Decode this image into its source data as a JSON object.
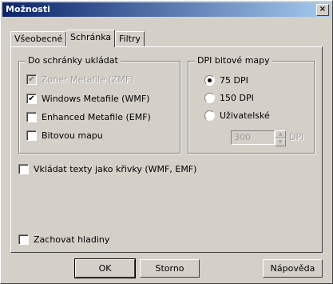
{
  "window": {
    "title": "Možnosti",
    "close_glyph": "×"
  },
  "tabs": [
    {
      "label": "Všeobecné",
      "active": false
    },
    {
      "label": "Schránka",
      "active": true
    },
    {
      "label": "Filtry",
      "active": false
    }
  ],
  "clipboard_group": {
    "legend": "Do schránky ukládat",
    "items": [
      {
        "label": "Zoner Metafile (ZMF)",
        "checked": true,
        "disabled": true
      },
      {
        "label": "Windows Metafile (WMF)",
        "checked": true,
        "disabled": false
      },
      {
        "label": "Enhanced Metafile (EMF)",
        "checked": false,
        "disabled": false
      },
      {
        "label": "Bitovou mapu",
        "checked": false,
        "disabled": false
      }
    ]
  },
  "dpi_group": {
    "legend": "DPI bitové mapy",
    "options": [
      {
        "label": "75 DPI",
        "selected": true
      },
      {
        "label": "150 DPI",
        "selected": false
      },
      {
        "label": "Uživatelské",
        "selected": false
      }
    ],
    "custom_value": "300",
    "custom_unit": "DPI"
  },
  "text_curves": {
    "label": "Vkládat texty jako křivky (WMF, EMF)",
    "checked": false
  },
  "keep_layers": {
    "label": "Zachovat hladiny",
    "checked": false
  },
  "buttons": {
    "ok": "OK",
    "cancel": "Storno",
    "help": "Nápověda"
  },
  "check_glyph": "✔"
}
